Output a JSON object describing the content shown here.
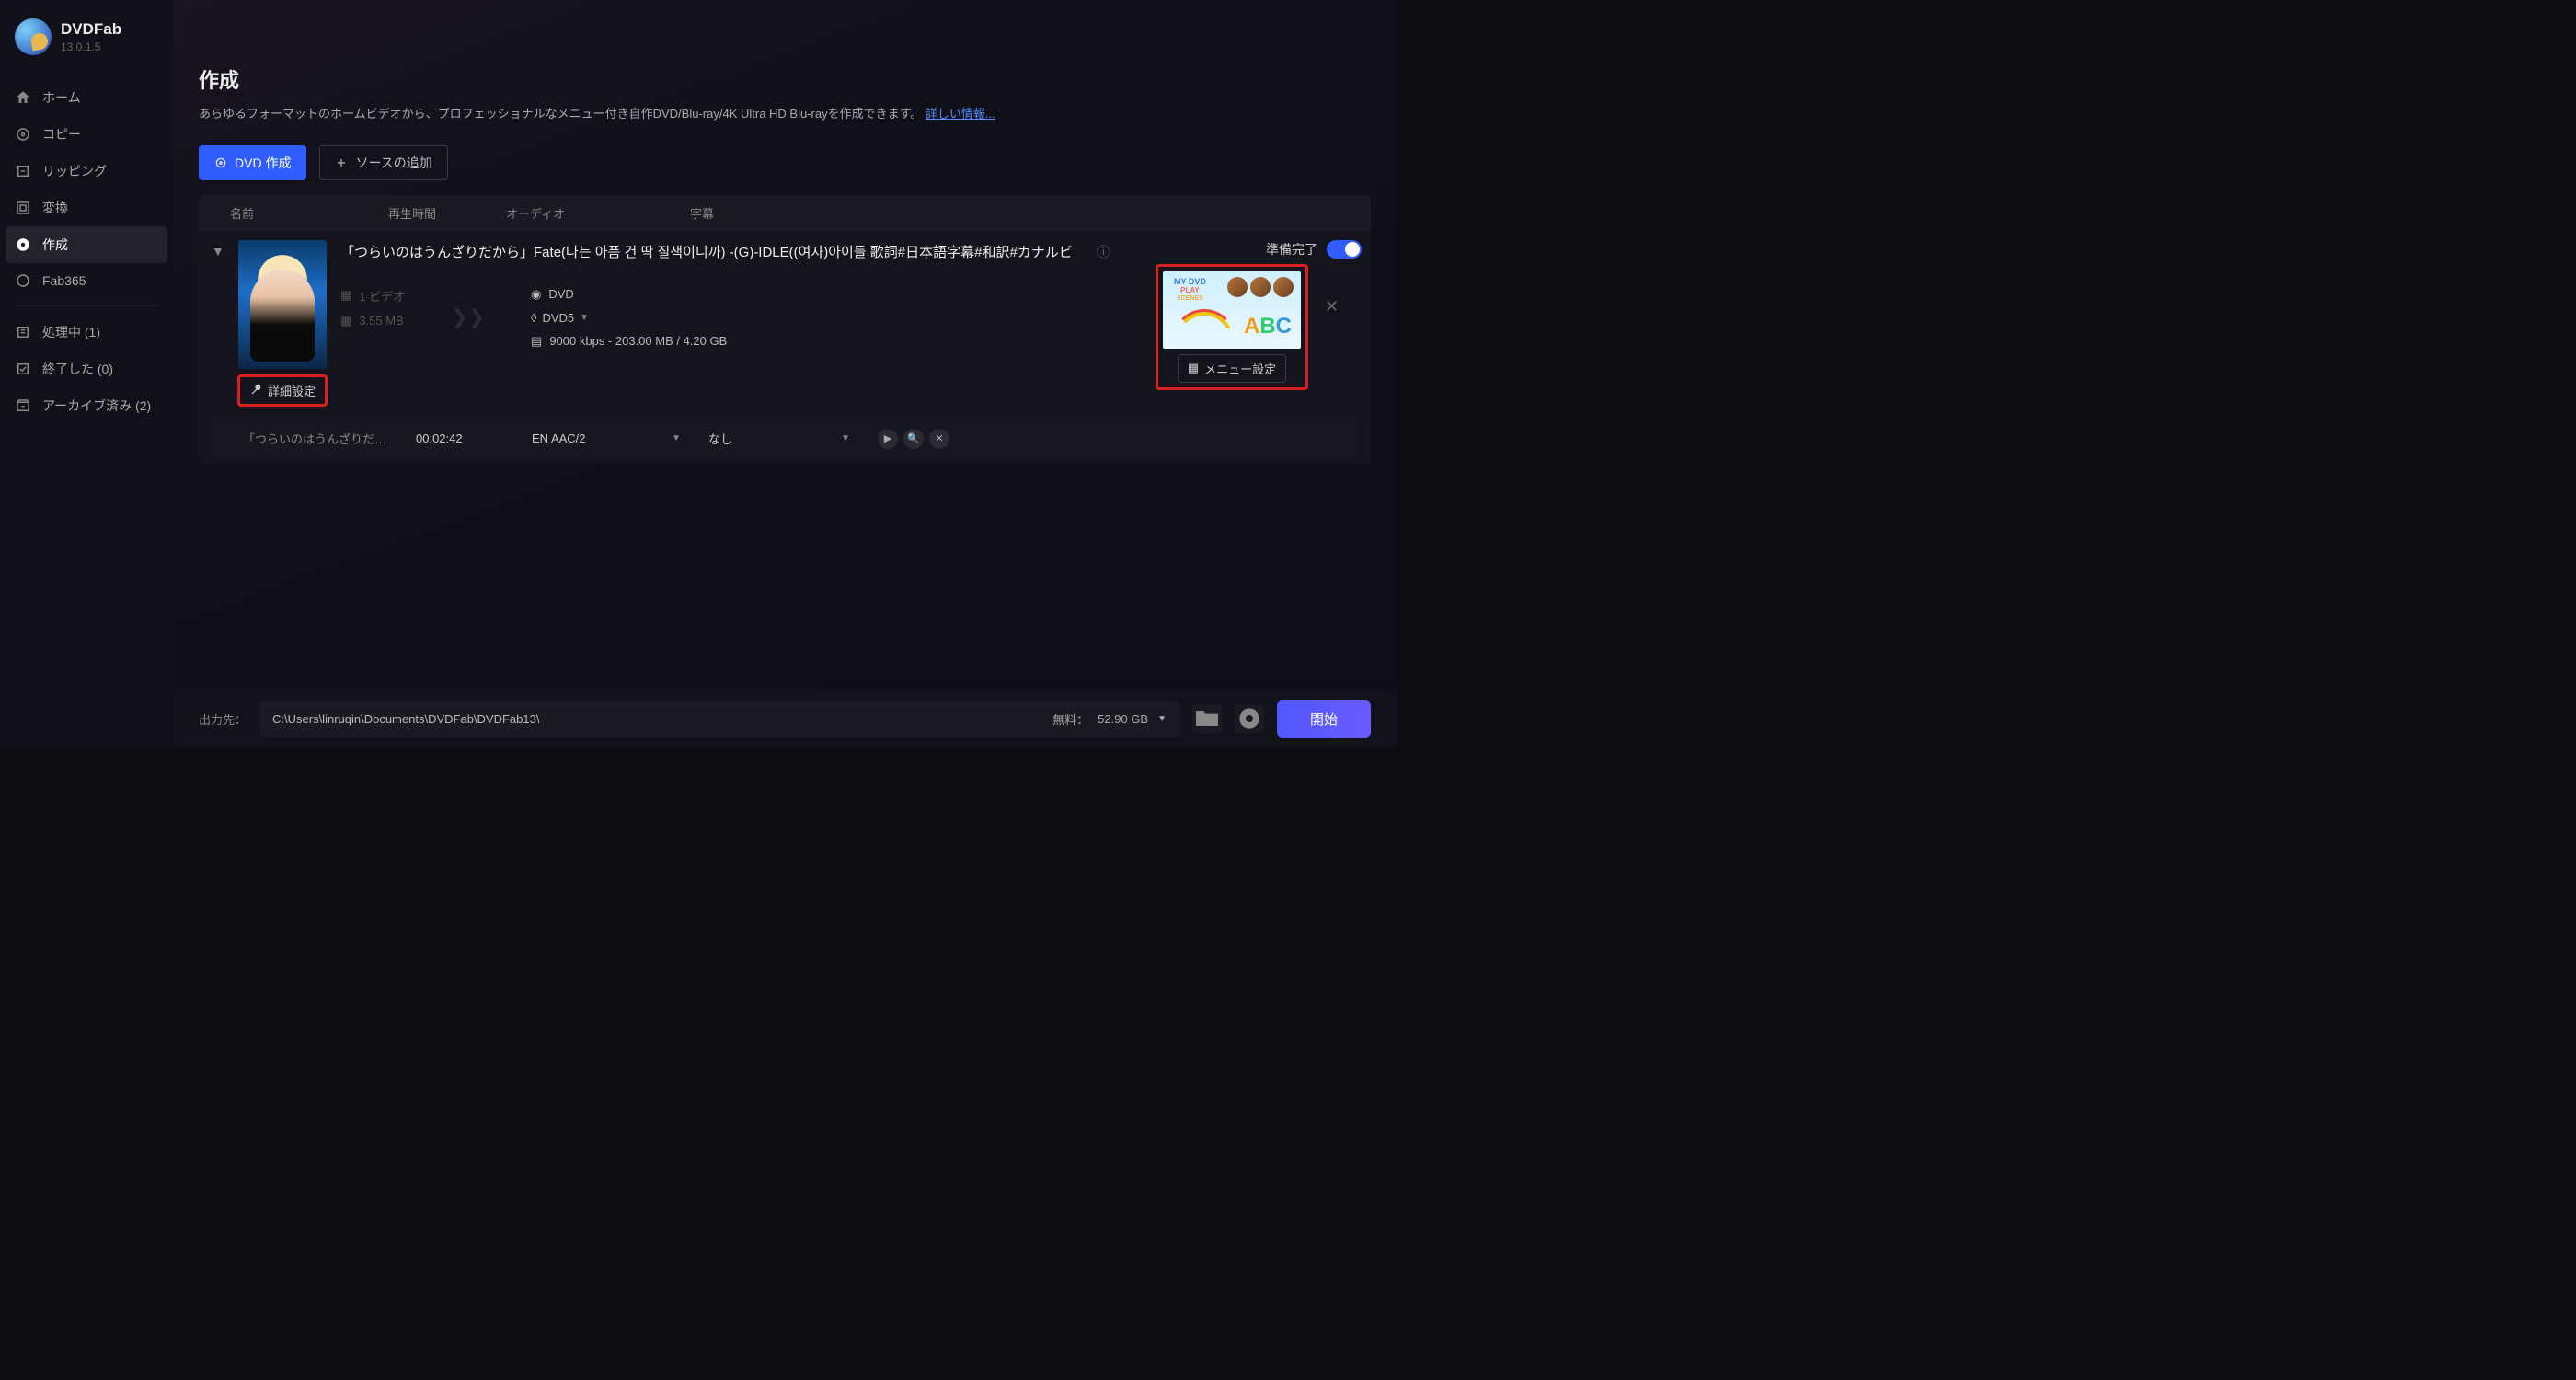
{
  "app": {
    "name": "DVDFab",
    "version": "13.0.1.5"
  },
  "titlebar_icons": [
    "store-icon",
    "menu-icon",
    "minimize-icon",
    "maximize-icon",
    "close-icon"
  ],
  "sidebar": {
    "items": [
      {
        "label": "ホーム",
        "icon": "home-icon"
      },
      {
        "label": "コピー",
        "icon": "copy-icon"
      },
      {
        "label": "リッピング",
        "icon": "ripping-icon"
      },
      {
        "label": "変換",
        "icon": "convert-icon"
      },
      {
        "label": "作成",
        "icon": "create-icon"
      },
      {
        "label": "Fab365",
        "icon": "fab365-icon"
      }
    ],
    "bottom": [
      {
        "label": "処理中 (1)"
      },
      {
        "label": "終了した (0)"
      },
      {
        "label": "アーカイブ済み (2)"
      }
    ]
  },
  "page": {
    "title": "作成",
    "desc": "あらゆるフォーマットのホームビデオから、プロフェッショナルなメニュー付き自作DVD/Blu-ray/4K Ultra HD Blu-rayを作成できます。",
    "more_link": "詳しい情報..."
  },
  "toolbar": {
    "dvd_create": "DVD 作成",
    "add_source": "ソースの追加"
  },
  "columns": {
    "name": "名前",
    "duration": "再生時間",
    "audio": "オーディオ",
    "subtitle": "字幕"
  },
  "item": {
    "title": "「つらいのはうんざりだから」Fate(나는 아픔 건 딱 질색이니까) -(G)-IDLE((여자)아이들 歌詞#日本語字幕#和訳#カナルビ",
    "videos": "1 ビデオ",
    "size": "3.55 MB",
    "disc_type": "DVD",
    "disc_format": "DVD5",
    "bitrate_line": "9000 kbps - 203.00 MB / 4.20 GB",
    "advanced_btn": "詳細設定",
    "menu_btn": "メニュー設定",
    "ready": "準備完了",
    "menu_preview": {
      "title": "MY DVD",
      "play": "PLAY",
      "scenes": "SCENES"
    },
    "row2": {
      "name": "「つらいのはうんざりだ…",
      "duration": "00:02:42",
      "audio": "EN  AAC/2",
      "subtitle": "なし"
    }
  },
  "footer": {
    "out_label": "出力先：",
    "out_path": "C:\\Users\\linruqin\\Documents\\DVDFab\\DVDFab13\\",
    "free_label": "無料：",
    "free_space": "52.90 GB",
    "start": "開始"
  }
}
